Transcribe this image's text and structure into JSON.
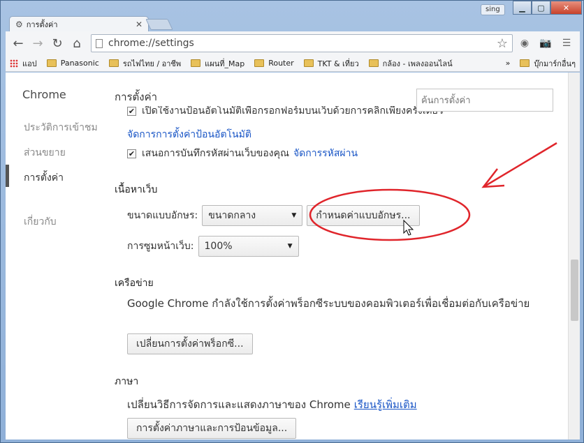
{
  "window": {
    "tab_title": "การตั้งค่า",
    "user_badge": "sing"
  },
  "toolbar": {
    "url": "chrome://settings"
  },
  "bookmarks": {
    "apps_label": "แอป",
    "items": [
      "Panasonic",
      "รถไฟไทย / อาชีพ",
      "แผนที่_Map",
      "Router",
      "TKT & เที่ยว",
      "กล้อง - เพลงออนไลน์"
    ],
    "more": "»",
    "other": "บุ๊กมาร์กอื่นๆ"
  },
  "sidebar": {
    "title": "Chrome",
    "items": [
      "ประวัติการเข้าชม",
      "ส่วนขยาย",
      "การตั้งค่า",
      "เกี่ยวกับ"
    ]
  },
  "settings": {
    "page_title": "การตั้งค่า",
    "search_placeholder": "ค้นการตั้งค่า",
    "autofill_text": "เปิดใช้งานป้อนอัตโนมัติเพื่อกรอกฟอร์มบนเว็บด้วยการคลิกเพียงครั้งเดียว",
    "autofill_link": "จัดการการตั้งค่าป้อนอัตโนมัติ",
    "password_text": "เสนอการบันทึกรหัสผ่านเว็บของคุณ",
    "password_link": "จัดการรหัสผ่าน",
    "web_content": {
      "heading": "เนื้อหาเว็บ",
      "font_size_label": "ขนาดแบบอักษร:",
      "font_size_value": "ขนาดกลาง",
      "customize_fonts_button": "กำหนดค่าแบบอักษร...",
      "zoom_label": "การซูมหน้าเว็บ:",
      "zoom_value": "100%"
    },
    "network": {
      "heading": "เครือข่าย",
      "description": "Google Chrome กำลังใช้การตั้งค่าพร็อกซีระบบของคอมพิวเตอร์เพื่อเชื่อมต่อกับเครือข่าย",
      "button": "เปลี่ยนการตั้งค่าพร็อกซี..."
    },
    "language": {
      "heading": "ภาษา",
      "description": "เปลี่ยนวิธีการจัดการและแสดงภาษาของ Chrome",
      "link": "เรียนรู้เพิ่มเติม",
      "button": "การตั้งค่าภาษาและการป้อนข้อมูล..."
    }
  },
  "colors": {
    "link": "#1a56c6",
    "annotation": "#e0252b"
  }
}
